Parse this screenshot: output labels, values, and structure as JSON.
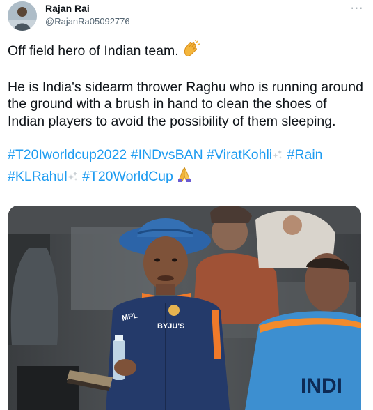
{
  "author": {
    "display_name": "Rajan Rai",
    "handle": "@RajanRa05092776"
  },
  "more_menu_label": "···",
  "tweet": {
    "line_1": "Off field hero of Indian team.",
    "line_1_emoji": "clapping-hands",
    "paragraph_2": "He is India's sidearm thrower Raghu who is running around the ground with a brush in hand to clean the shoes of Indian players to avoid the possibility of them sleeping.",
    "hashtags": [
      {
        "text": "#T20Iworldcup2022"
      },
      {
        "text": "#INDvsBAN"
      },
      {
        "text": "#ViratKohli",
        "emoji": "sparkles"
      },
      {
        "text": "#Rain"
      },
      {
        "text": "#KLRahul",
        "emoji": "sparkles"
      },
      {
        "text": "#T20WorldCup",
        "emoji": "folded-hands"
      }
    ]
  },
  "media": {
    "jersey_logo_text": "BYJU'S",
    "jersey_sleeve_text": "MPL",
    "shirt_text": "INDI"
  }
}
